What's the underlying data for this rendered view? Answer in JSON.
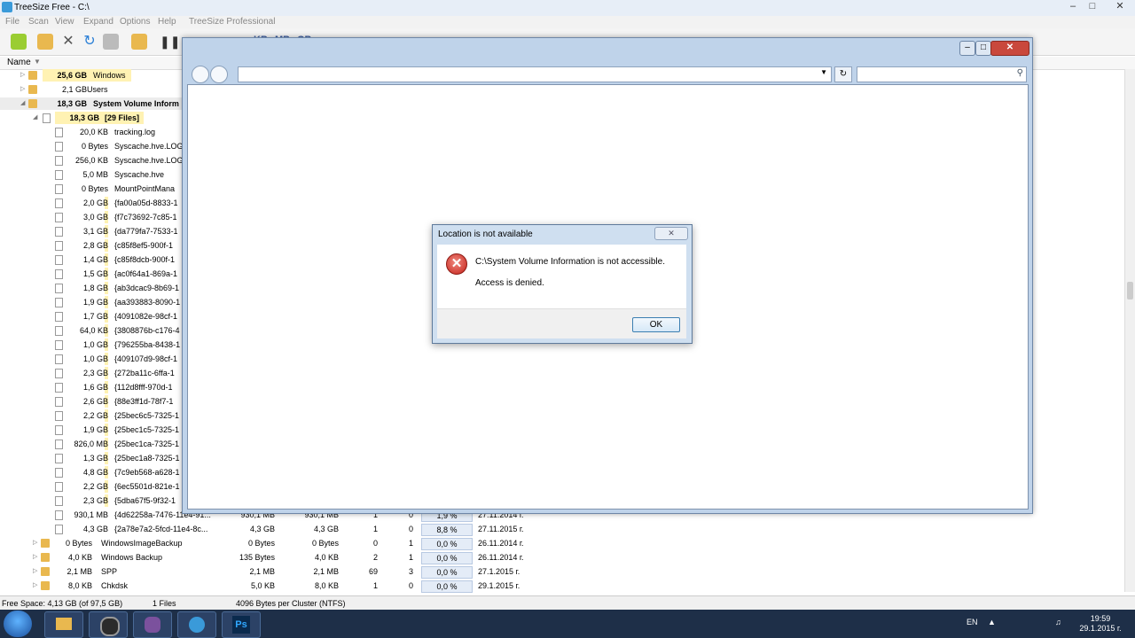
{
  "app": {
    "title": "TreeSize Free - C:\\"
  },
  "menu": [
    "File",
    "Scan",
    "View",
    "Expand",
    "Options",
    "Help",
    "TreeSize Professional"
  ],
  "toolbar": {
    "kb": "KB",
    "mb": "MB",
    "gb": "GB"
  },
  "tree": {
    "header_name": "Name",
    "top_rows": [
      {
        "size": "25,6 GB",
        "name": "Windows"
      },
      {
        "size": "2,1 GB",
        "name": "Users"
      },
      {
        "size": "18,3 GB",
        "name": "System Volume Inform"
      },
      {
        "size": "18,3 GB",
        "name": "[29 Files]"
      }
    ],
    "files": [
      {
        "size": "20,0 KB",
        "name": "tracking.log"
      },
      {
        "size": "0 Bytes",
        "name": "Syscache.hve.LOG"
      },
      {
        "size": "256,0 KB",
        "name": "Syscache.hve.LOG"
      },
      {
        "size": "5,0 MB",
        "name": "Syscache.hve"
      },
      {
        "size": "0 Bytes",
        "name": "MountPointMana"
      },
      {
        "size": "2,0 GB",
        "name": "{fa00a05d-8833-1"
      },
      {
        "size": "3,0 GB",
        "name": "{f7c73692-7c85-1"
      },
      {
        "size": "3,1 GB",
        "name": "{da779fa7-7533-1"
      },
      {
        "size": "2,8 GB",
        "name": "{c85f8ef5-900f-1"
      },
      {
        "size": "1,4 GB",
        "name": "{c85f8dcb-900f-1"
      },
      {
        "size": "1,5 GB",
        "name": "{ac0f64a1-869a-1"
      },
      {
        "size": "1,8 GB",
        "name": "{ab3dcac9-8b69-1"
      },
      {
        "size": "1,9 GB",
        "name": "{aa393883-8090-1"
      },
      {
        "size": "1,7 GB",
        "name": "{4091082e-98cf-1"
      },
      {
        "size": "64,0 KB",
        "name": "{3808876b-c176-4"
      },
      {
        "size": "1,0 GB",
        "name": "{796255ba-8438-1"
      },
      {
        "size": "1,0 GB",
        "name": "{409107d9-98cf-1"
      },
      {
        "size": "2,3 GB",
        "name": "{272ba11c-6ffa-1"
      },
      {
        "size": "1,6 GB",
        "name": "{112d8fff-970d-1"
      },
      {
        "size": "2,6 GB",
        "name": "{88e3ff1d-78f7-1"
      },
      {
        "size": "2,2 GB",
        "name": "{25bec6c5-7325-1"
      },
      {
        "size": "1,9 GB",
        "name": "{25bec1c5-7325-1"
      },
      {
        "size": "826,0 MB",
        "name": "{25bec1ca-7325-1"
      },
      {
        "size": "1,3 GB",
        "name": "{25bec1a8-7325-1"
      },
      {
        "size": "4,8 GB",
        "name": "{7c9eb568-a628-1"
      },
      {
        "size": "2,2 GB",
        "name": "{6ec5501d-821e-1"
      },
      {
        "size": "2,3 GB",
        "name": "{5dba67f5-9f32-1"
      }
    ],
    "visible_rows": [
      {
        "size": "930,1 MB",
        "name": "{4d62258a-7476-11e4-91...",
        "c1": "930,1 MB",
        "c2": "930,1 MB",
        "c3": "1",
        "c4": "0",
        "pct": "1,9 %",
        "date": "27.11.2014 г."
      },
      {
        "size": "4,3 GB",
        "name": "{2a78e7a2-5fcd-11e4-8c...",
        "c1": "4,3 GB",
        "c2": "4,3 GB",
        "c3": "1",
        "c4": "0",
        "pct": "8,8 %",
        "date": "27.11.2015 г."
      }
    ],
    "folder_rows": [
      {
        "size": "0 Bytes",
        "name": "WindowsImageBackup",
        "c1": "0 Bytes",
        "c2": "0 Bytes",
        "c3": "0",
        "c4": "1",
        "pct": "0,0 %",
        "date": "26.11.2014 г."
      },
      {
        "size": "4,0 KB",
        "name": "Windows Backup",
        "c1": "135 Bytes",
        "c2": "4,0 KB",
        "c3": "2",
        "c4": "1",
        "pct": "0,0 %",
        "date": "26.11.2014 г."
      },
      {
        "size": "2,1 MB",
        "name": "SPP",
        "c1": "2,1 MB",
        "c2": "2,1 MB",
        "c3": "69",
        "c4": "3",
        "pct": "0,0 %",
        "date": "27.1.2015 г."
      },
      {
        "size": "8,0 KB",
        "name": "Chkdsk",
        "c1": "5,0 KB",
        "c2": "8,0 KB",
        "c3": "1",
        "c4": "0",
        "pct": "0,0 %",
        "date": "29.1.2015 г."
      }
    ]
  },
  "status": {
    "free_space": "Free Space: 4,13 GB  (of 97,5 GB)",
    "files": "1  Files",
    "cluster": "4096 Bytes per Cluster (NTFS)"
  },
  "dialog": {
    "title": "Location is not available",
    "message": "C:\\System Volume Information is not accessible.",
    "detail": "Access is denied.",
    "ok": "OK"
  },
  "taskbar": {
    "lang": "EN",
    "time": "19:59",
    "date": "29.1.2015 г."
  },
  "colors": {
    "error_red": "#c52018",
    "folder": "#e9b84f",
    "highlight": "#fff2b3"
  }
}
